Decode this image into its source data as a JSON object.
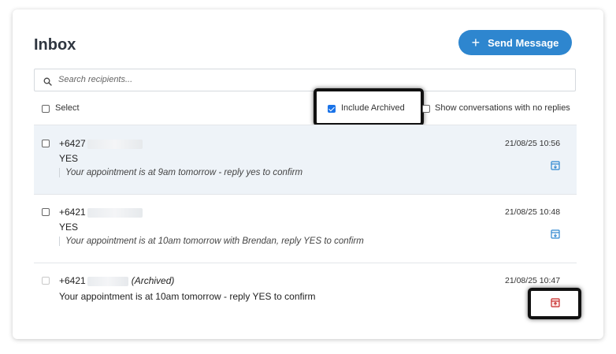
{
  "header": {
    "title": "Inbox",
    "send_label": "Send Message",
    "send_icon": "plus-icon"
  },
  "search": {
    "placeholder": "Search recipients...",
    "value": ""
  },
  "filters": {
    "select_label": "Select",
    "include_archived_label": "Include Archived",
    "include_archived_checked": true,
    "no_replies_label": "Show conversations with no replies",
    "no_replies_checked": false
  },
  "conversations": [
    {
      "phone": "+6427",
      "reply": "YES",
      "message": "Your appointment is at 9am tomorrow - reply yes to confirm",
      "time": "21/08/25 10:56",
      "action_icon": "archive-icon",
      "archived": false
    },
    {
      "phone": "+6421",
      "reply": "YES",
      "message": "Your appointment is at 10am tomorrow with Brendan, reply YES to confirm",
      "time": "21/08/25 10:48",
      "action_icon": "archive-icon",
      "archived": false
    },
    {
      "phone": "+6421",
      "archived_label": "(Archived)",
      "message": "Your appointment is at 10am tomorrow - reply YES to confirm",
      "time": "21/08/25 10:47",
      "action_icon": "unarchive-icon",
      "archived": true
    }
  ],
  "colors": {
    "accent": "#2e86cf",
    "archive_icon": "#2e86cf",
    "unarchive_icon": "#c62828",
    "row_highlight": "#eef3f8"
  }
}
